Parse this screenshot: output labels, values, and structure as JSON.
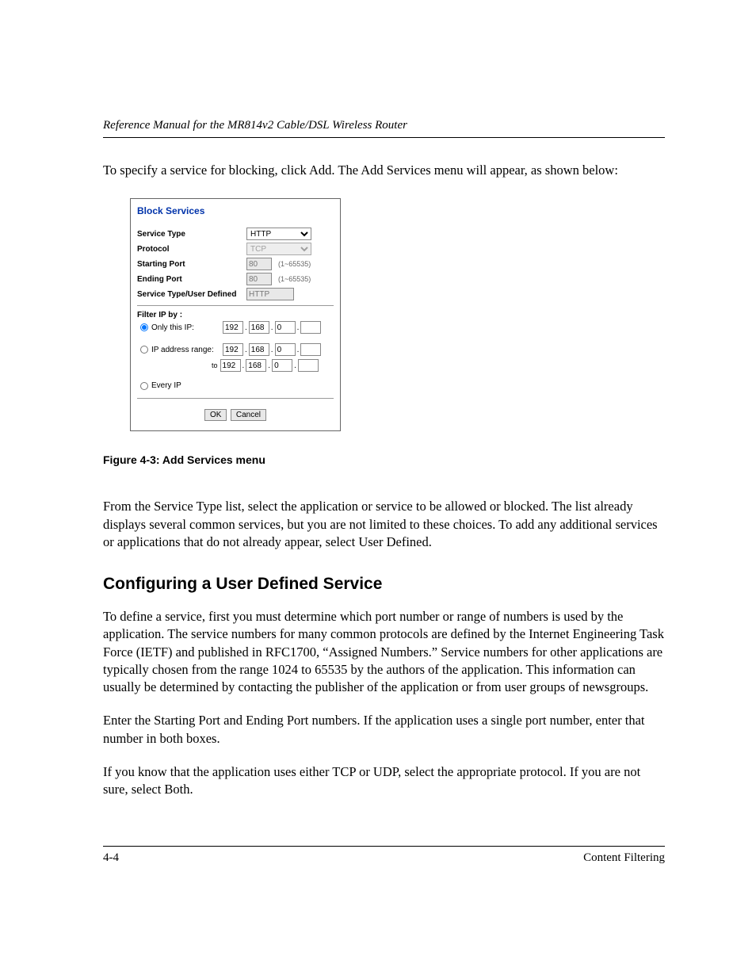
{
  "header": "Reference Manual for the MR814v2 Cable/DSL Wireless Router",
  "intro": "To specify a service for blocking, click Add. The Add Services menu will appear, as shown below:",
  "screenshot": {
    "title": "Block Services",
    "rows": {
      "service_type": {
        "label": "Service Type",
        "value": "HTTP"
      },
      "protocol": {
        "label": "Protocol",
        "value": "TCP"
      },
      "starting_port": {
        "label": "Starting Port",
        "value": "80",
        "range": "(1~65535)"
      },
      "ending_port": {
        "label": "Ending Port",
        "value": "80",
        "range": "(1~65535)"
      },
      "user_defined": {
        "label": "Service Type/User Defined",
        "value": "HTTP"
      }
    },
    "filter": {
      "heading": "Filter IP by :",
      "only": {
        "label": "Only this IP:",
        "ip": [
          "192",
          "168",
          "0",
          ""
        ]
      },
      "range": {
        "label": "IP address range:",
        "from": [
          "192",
          "168",
          "0",
          ""
        ],
        "to_label": "to",
        "to": [
          "192",
          "168",
          "0",
          ""
        ]
      },
      "every": {
        "label": "Every IP"
      }
    },
    "buttons": {
      "ok": "OK",
      "cancel": "Cancel"
    }
  },
  "figure_caption": "Figure 4-3:  Add Services menu",
  "para1": "From the Service Type list, select the application or service to be allowed or blocked. The list already displays several common services, but you are not limited to these choices. To add any additional services or applications that do not already appear, select User Defined.",
  "section_heading": "Configuring a User Defined Service",
  "para2": "To define a service, first you must determine which port number or range of numbers is used by the application. The service numbers for many common protocols are defined by the Internet Engineering Task Force (IETF) and published in RFC1700, “Assigned Numbers.” Service numbers for other applications are typically chosen from the range 1024 to 65535 by the authors of the application. This information can usually be determined by contacting the publisher of the application or from user groups of newsgroups.",
  "para3": "Enter the Starting Port and Ending Port numbers. If the application uses a single port number, enter that number in both boxes.",
  "para4": "If you know that the application uses either TCP or UDP, select the appropriate protocol. If you are not sure, select Both.",
  "footer": {
    "page": "4-4",
    "section": "Content Filtering"
  }
}
